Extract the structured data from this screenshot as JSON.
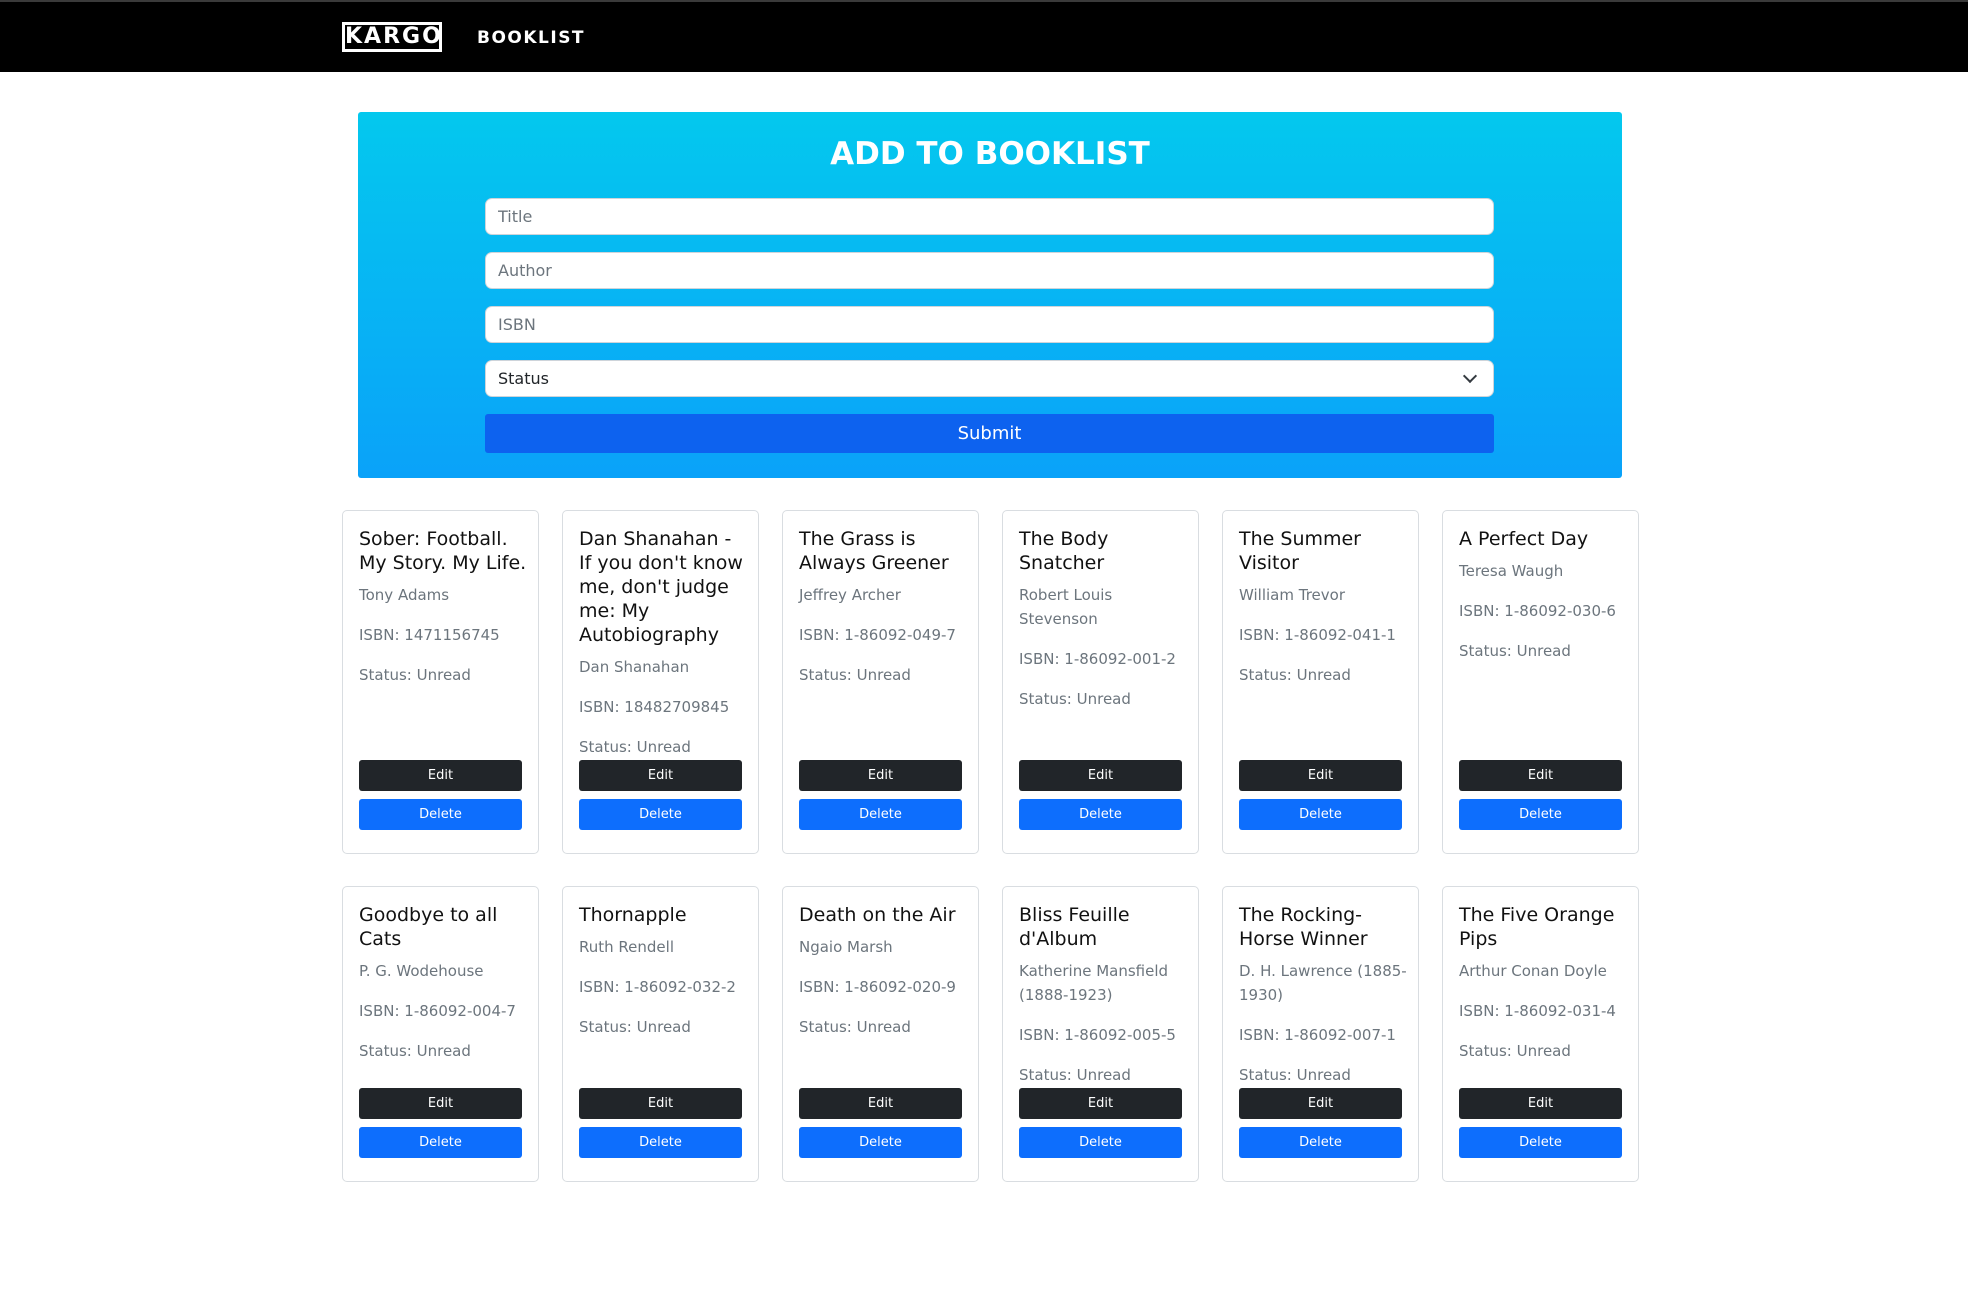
{
  "nav": {
    "logo": "KARGO",
    "title": "BOOKLIST"
  },
  "form": {
    "heading": "ADD TO BOOKLIST",
    "title_placeholder": "Title",
    "author_placeholder": "Author",
    "isbn_placeholder": "ISBN",
    "status_value": "Status",
    "submit_label": "Submit"
  },
  "card_buttons": {
    "edit": "Edit",
    "delete": "Delete"
  },
  "books": [
    {
      "title": "Sober: Football. My Story. My Life.",
      "author": "Tony Adams",
      "isbn": "ISBN: 1471156745",
      "status": "Status: Unread"
    },
    {
      "title": "Dan Shanahan - If you don't know me, don't judge me: My Autobiography",
      "author": "Dan Shanahan",
      "isbn": "ISBN: 18482709845",
      "status": "Status: Unread"
    },
    {
      "title": "The Grass is Always Greener",
      "author": "Jeffrey Archer",
      "isbn": "ISBN: 1-86092-049-7",
      "status": "Status: Unread"
    },
    {
      "title": "The Body Snatcher",
      "author": "Robert Louis Stevenson",
      "isbn": "ISBN: 1-86092-001-2",
      "status": "Status: Unread"
    },
    {
      "title": "The Summer Visitor",
      "author": "William Trevor",
      "isbn": "ISBN: 1-86092-041-1",
      "status": "Status: Unread"
    },
    {
      "title": "A Perfect Day",
      "author": "Teresa Waugh",
      "isbn": "ISBN: 1-86092-030-6",
      "status": "Status: Unread"
    },
    {
      "title": "Goodbye to all Cats",
      "author": "P. G. Wodehouse",
      "isbn": "ISBN: 1-86092-004-7",
      "status": "Status: Unread"
    },
    {
      "title": "Thornapple",
      "author": "Ruth Rendell",
      "isbn": "ISBN: 1-86092-032-2",
      "status": "Status: Unread"
    },
    {
      "title": "Death on the Air",
      "author": "Ngaio Marsh",
      "isbn": "ISBN: 1-86092-020-9",
      "status": "Status: Unread"
    },
    {
      "title": "Bliss Feuille d'Album",
      "author": "Katherine Mansfield (1888-1923)",
      "isbn": "ISBN: 1-86092-005-5",
      "status": "Status: Unread"
    },
    {
      "title": "The Rocking-Horse Winner",
      "author": "D. H. Lawrence (1885-1930)",
      "isbn": "ISBN: 1-86092-007-1",
      "status": "Status: Unread"
    },
    {
      "title": "The Five Orange Pips",
      "author": "Arthur Conan Doyle",
      "isbn": "ISBN: 1-86092-031-4",
      "status": "Status: Unread"
    }
  ]
}
